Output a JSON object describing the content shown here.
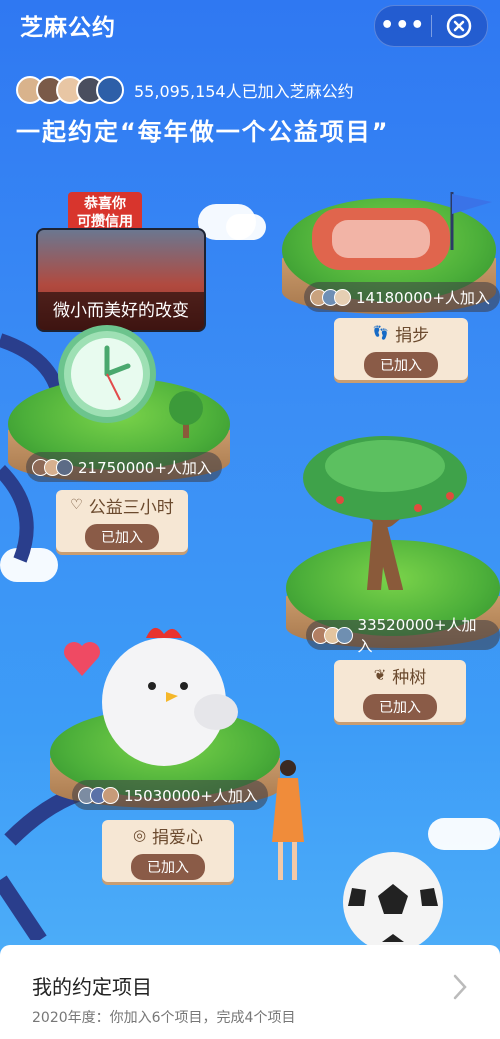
{
  "header": {
    "title": "芝麻公约",
    "more_icon": "more-dots-icon",
    "close_icon": "close-circle-icon"
  },
  "summary": {
    "joined_text": "55,095,154人已加入芝麻公约",
    "headline": "一起约定“每年做一个公益项目”"
  },
  "featured": {
    "stamp_line1": "恭喜你",
    "stamp_line2": "可攒信用",
    "caption": "微小而美好的改变"
  },
  "projects": [
    {
      "name": "捐步",
      "count": "14180000+人加入",
      "status": "已加入",
      "icon": "footsteps-icon"
    },
    {
      "name": "公益三小时",
      "count": "21750000+人加入",
      "status": "已加入",
      "icon": "heart-hand-icon"
    },
    {
      "name": "种树",
      "count": "33520000+人加入",
      "status": "已加入",
      "icon": "sprout-icon"
    },
    {
      "name": "捐爱心",
      "count": "15030000+人加入",
      "status": "已加入",
      "icon": "egg-heart-icon"
    }
  ],
  "bottom": {
    "title": "我的约定项目",
    "subtitle": "2020年度：你加入6个项目，完成4个项目",
    "arrow_icon": "chevron-right-icon"
  },
  "colors": {
    "sky": "#3b8ef5",
    "grass": "#4caf3a",
    "sign_bg": "#f6e7d4",
    "joined_btn": "#8a5b47",
    "stamp_red": "#d8352d"
  }
}
